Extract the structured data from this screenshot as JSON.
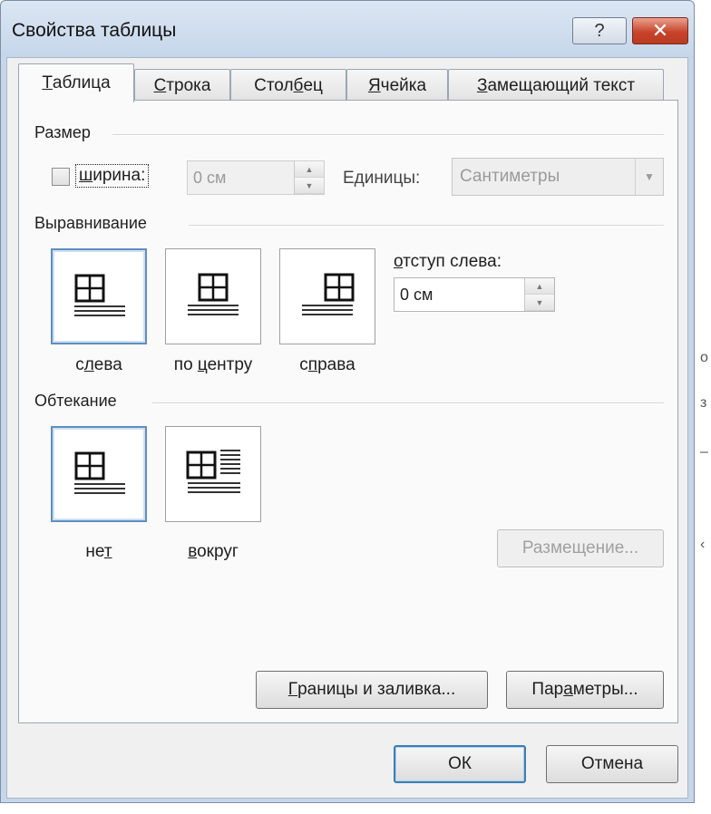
{
  "window": {
    "title": "Свойства таблицы",
    "help_glyph": "?",
    "close_glyph": "✕"
  },
  "tabs": [
    {
      "label": "Таблица",
      "underline": "Т",
      "rest": "аблица"
    },
    {
      "label": "Строка",
      "underline": "С",
      "rest": "трока"
    },
    {
      "label": "Столбец",
      "pre": "Стол",
      "underline": "б",
      "rest": "ец"
    },
    {
      "label": "Ячейка",
      "underline": "Я",
      "rest": "чейка"
    },
    {
      "label": "Замещающий текст",
      "underline": "З",
      "rest": "амещающий текст"
    }
  ],
  "size_group": {
    "label": "Размер",
    "width_checkbox": {
      "label": "ширина:",
      "underline": "ш",
      "rest": "ирина:",
      "checked": false
    },
    "width_value": "0 см",
    "units_label": "Единицы:",
    "units_value": "Сантиметры"
  },
  "alignment_group": {
    "label": "Выравнивание",
    "options": [
      {
        "label": "слева",
        "pre": "с",
        "underline": "л",
        "rest": "ева",
        "selected": true
      },
      {
        "label": "по центру",
        "pre": "по ",
        "underline": "ц",
        "rest": "ентру",
        "selected": false
      },
      {
        "label": "справа",
        "pre": "с",
        "underline": "п",
        "rest": "рава",
        "selected": false
      }
    ],
    "indent_label": "отступ слева:",
    "indent_underline": "о",
    "indent_rest": "тступ слева:",
    "indent_value": "0 см"
  },
  "wrapping_group": {
    "label": "Обтекание",
    "options": [
      {
        "label": "нет",
        "pre": "не",
        "underline": "т",
        "rest": "",
        "selected": true
      },
      {
        "label": "вокруг",
        "pre": "",
        "underline": "в",
        "rest": "округ",
        "selected": false
      }
    ],
    "placement_button": "Размещение..."
  },
  "bottom_buttons": {
    "borders": "Границы и заливка...",
    "borders_underline": "Г",
    "borders_rest": "раницы и заливка...",
    "options": "Параметры...",
    "options_pre": "Пар",
    "options_underline": "а",
    "options_rest": "метры..."
  },
  "dialog_buttons": {
    "ok": "ОК",
    "cancel": "Отмена"
  },
  "side_glyphs": [
    "о",
    "з",
    "–",
    "‹"
  ],
  "colors": {
    "accent": "#5f8fbf",
    "titlebar": "#c7d7ea",
    "close": "#c8442b"
  }
}
